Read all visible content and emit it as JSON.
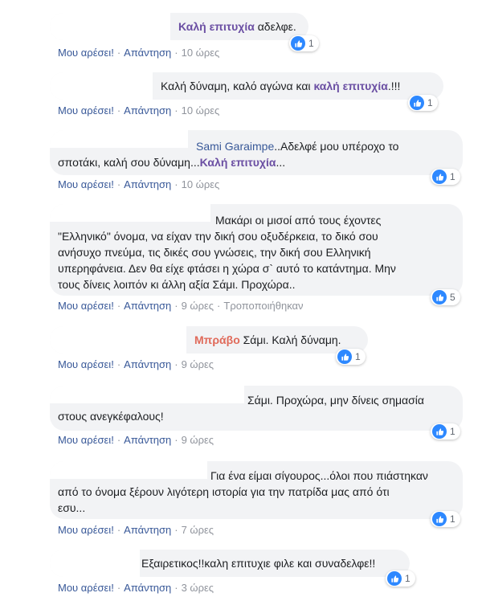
{
  "actions": {
    "like": "Μου αρέσει!",
    "reply": "Απάντηση",
    "edited": "Τροποποιήθηκαν"
  },
  "comments": [
    {
      "lines": [
        {
          "tag": "Καλή επιτυχία",
          "text": " αδελφε."
        }
      ],
      "time": "10 ώρες",
      "likes": "1"
    },
    {
      "lines": [
        {
          "text": "Καλή δύναμη, καλό αγώνα και ",
          "tag": "καλή επιτυχία",
          "tail": ".!!!"
        }
      ],
      "time": "10 ώρες",
      "likes": "1"
    },
    {
      "name": "Sami Garaimpe",
      "lines": [
        {
          "text": "..Αδελφέ μου υπέροχο το"
        },
        {
          "text": "σποτάκι, καλή σου δύναμη...",
          "tag": "Καλή επιτυχία",
          "tail": "..."
        }
      ],
      "time": "10 ώρες",
      "likes": "1"
    },
    {
      "lines": [
        {
          "text": "Μακάρι οι μισοί από τους έχοντες"
        },
        {
          "text": "\"Ελληνικό\" όνομα, να είχαν την δική σου οξυδέρκεια, το δικό σου"
        },
        {
          "text": "ανήσυχο πνεύμα, τις δικές σου γνώσεις, την δική σου Ελληνική"
        },
        {
          "text": "υπερηφάνεια. Δεν θα είχε φτάσει η χώρα σ` αυτό το κατάντημα. Μην"
        },
        {
          "text": "τους δίνεις λοιπόν κι άλλη αξία Σάμι. Προχώρα.."
        }
      ],
      "time": "9 ώρες",
      "edited": true,
      "likes": "5"
    },
    {
      "lines": [
        {
          "tag_red": "Μπράβο",
          "text": " Σάμι. Καλή δύναμη."
        }
      ],
      "time": "9 ώρες",
      "likes": "1"
    },
    {
      "lines": [
        {
          "text": "Σάμι. Προχώρα, μην δίνεις σημασία"
        },
        {
          "text": "στους ανεγκέφαλους!"
        }
      ],
      "time": "9 ώρες",
      "likes": "1"
    },
    {
      "lines": [
        {
          "text": "Για ένα είμαι σίγουρος...όλοι που πιάστηκαν"
        },
        {
          "text": "από το όνομα ξέρουν λιγότερη ιστορία για την πατρίδα μας από ότι"
        },
        {
          "text": "εσυ..."
        }
      ],
      "time": "7 ώρες",
      "likes": "1"
    },
    {
      "lines": [
        {
          "text": "Εξαιρετικος!!καλη επιτυχιε φιλε και συναδελφε!!"
        }
      ],
      "time": "3 ώρες",
      "likes": "1"
    }
  ],
  "colors": {
    "bubble": "#f2f3f5",
    "link": "#385898",
    "meta": "#90949c",
    "like": "#2d88ff"
  },
  "icons": {
    "like": "thumbs-up-icon"
  }
}
